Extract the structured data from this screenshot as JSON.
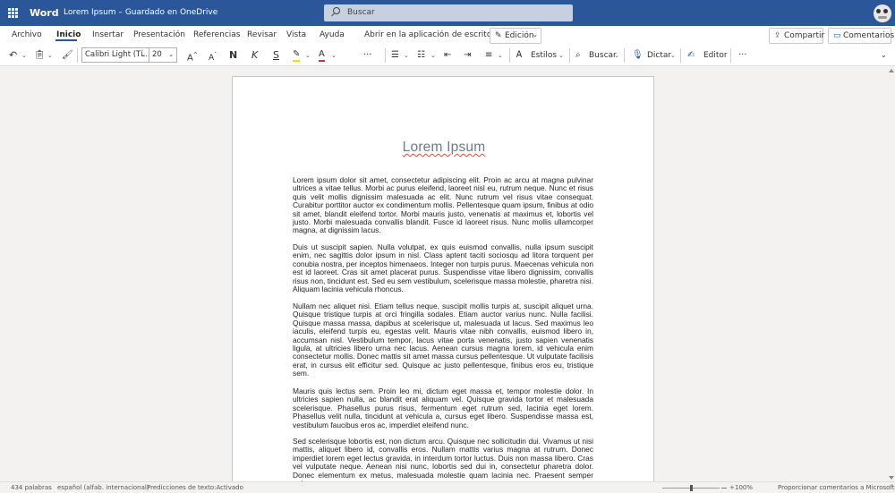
{
  "app": {
    "name": "Word",
    "doc_title": "Lorem Ipsum",
    "save_status": "Guardado en OneDrive"
  },
  "search": {
    "placeholder": "Buscar"
  },
  "menu": {
    "tabs": [
      "Archivo",
      "Inicio",
      "Insertar",
      "Presentación",
      "Referencias",
      "Revisar",
      "Vista",
      "Ayuda",
      "Abrir en la aplicación de escritorio"
    ],
    "active_tab": "Inicio",
    "mode_label": "Edición",
    "share_label": "Compartir",
    "comments_label": "Comentarios"
  },
  "ribbon": {
    "font_name": "Calibri Light (Tí...",
    "font_size": "20",
    "grow_label": "A",
    "shrink_label": "A",
    "bold_label": "N",
    "italic_label": "K",
    "strike_label": "S",
    "font_color_label": "A",
    "more_label": "···",
    "styles_label": "Estilos",
    "find_label": "Buscar",
    "dictate_label": "Dictar",
    "editor_label": "Editor",
    "overflow_label": "···",
    "accent_color": "#2b579a",
    "highlight_color": "#ffd700",
    "font_color": "#d13438"
  },
  "document": {
    "title": "Lorem Ipsum",
    "paragraphs": [
      "Lorem ipsum dolor sit amet, consectetur adipiscing elit. Proin ac arcu at magna pulvinar ultrices a vitae tellus. Morbi ac purus eleifend, laoreet nisl eu, rutrum neque. Nunc et risus quis velit mollis dignissim malesuada ac elit. Nunc rutrum vel risus vitae consequat. Curabitur porttitor auctor ex condimentum mollis. Pellentesque quam ipsum, finibus at odio sit amet, blandit eleifend tortor. Morbi mauris justo, venenatis at maximus et, lobortis vel justo. Morbi malesuada convallis blandit. Fusce id laoreet risus. Nunc mollis ullamcorper magna, at dignissim lacus.",
      "Duis ut suscipit sapien. Nulla volutpat, ex quis euismod convallis, nulla ipsum suscipit enim, nec sagittis dolor ipsum in nisl. Class aptent taciti sociosqu ad litora torquent per conubia nostra, per inceptos himenaeos. Integer non turpis purus. Maecenas vehicula non est id laoreet. Cras sit amet placerat purus. Suspendisse vitae libero dignissim, convallis risus non, tincidunt est. Sed eu sem vestibulum, scelerisque massa molestie, pharetra nisi. Aliquam lacinia vehicula rhoncus.",
      "Nullam nec aliquet nisi. Etiam tellus neque, suscipit mollis turpis at, suscipit aliquet urna. Quisque tristique turpis at orci fringilla sodales. Etiam auctor varius nunc. Nulla facilisi. Quisque massa massa, dapibus at scelerisque ut, malesuada ut lacus. Sed maximus leo iaculis, eleifend turpis eu, egestas velit. Mauris vitae nibh convallis, euismod libero in, accumsan nisl. Vestibulum tempor, lacus vitae porta venenatis, justo sapien venenatis ligula, at ultricies libero urna nec lacus. Aenean cursus magna lorem, id vehicula enim consectetur mollis. Donec mattis sit amet massa cursus pellentesque. Ut vulputate facilisis erat, in cursus elit efficitur sed. Quisque ac justo pellentesque, finibus eros eu, tristique sem.",
      "Mauris quis lectus sem. Proin leo mi, dictum eget massa et, tempor molestie dolor. In ultricies sapien nulla, ac blandit erat aliquam vel. Quisque gravida tortor et malesuada scelerisque. Phasellus purus risus, fermentum eget rutrum sed, lacinia eget lorem. Phasellus velit nulla, tincidunt at vehicula a, cursus eget libero. Suspendisse massa est, vestibulum faucibus eros ac, imperdiet eleifend nunc.",
      "Sed scelerisque lobortis est, non dictum arcu. Quisque nec sollicitudin dui. Vivamus ut nisi mattis, aliquet libero id, convallis eros. Nullam mattis varius magna at rutrum. Donec imperdiet lorem eget lectus gravida, in interdum tortor luctus. Duis non massa libero. Cras vel vulputate neque. Aenean nisi nunc, lobortis sed dui in, consectetur pharetra dolor. Donec elementum ex metus, malesuada molestie quam lacinia nec. Praesent semper enim"
    ]
  },
  "status": {
    "word_count": "434 palabras",
    "language": "español (alfab. internacional)",
    "predictions": "Predicciones de texto:Activado",
    "zoom": "100%",
    "feedback": "Proporcionar comentarios a Microsoft"
  }
}
